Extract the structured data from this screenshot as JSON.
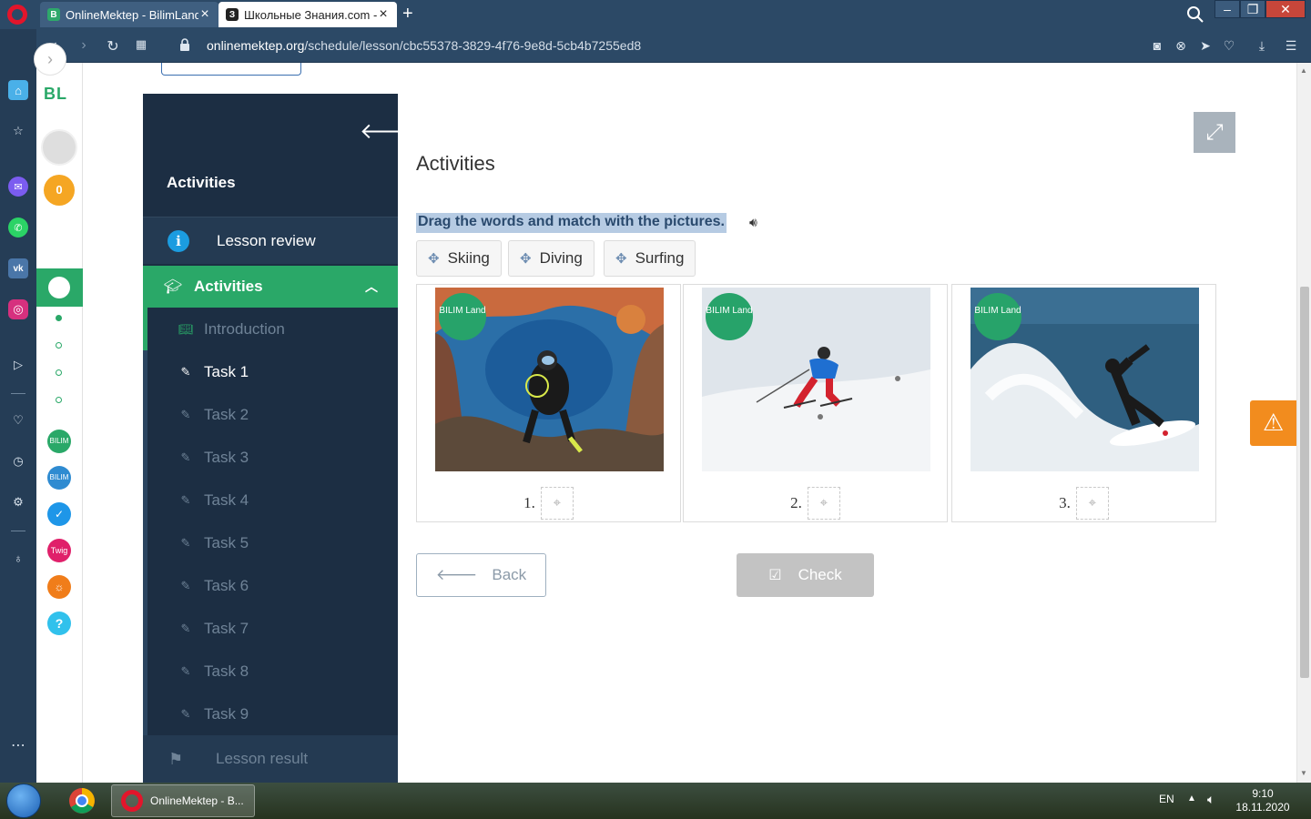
{
  "browser": {
    "tabs": [
      {
        "favicon": "B",
        "title": "OnlineMektep - BilimLand"
      },
      {
        "favicon": "З",
        "title": "Школьные Знания.com - I"
      }
    ],
    "url_host": "onlinemektep.org",
    "url_path": "/schedule/lesson/cbc55378-3829-4f76-9e8d-5cb4b7255ed8"
  },
  "site_sidebar": {
    "logo": "BL",
    "coins": "0",
    "apps": [
      {
        "label": "BILIM Land",
        "color": "#2aa868"
      },
      {
        "label": "BILIM Book",
        "color": "#2f8bd1"
      },
      {
        "label": "✓",
        "color": "#1e96e8"
      },
      {
        "label": "Twig",
        "color": "#e0206a"
      },
      {
        "label": "☼",
        "color": "#f07d1a"
      },
      {
        "label": "?",
        "color": "#31c1ec"
      }
    ]
  },
  "lesson_nav": {
    "title": "Activities",
    "review": "Lesson review",
    "section": "Activities",
    "items": [
      "Introduction",
      "Task 1",
      "Task 2",
      "Task 3",
      "Task 4",
      "Task 5",
      "Task 6",
      "Task 7",
      "Task 8",
      "Task 9"
    ],
    "result": "Lesson result"
  },
  "activity": {
    "heading": "Activities",
    "instruction": "Drag the words and match with the pictures.",
    "words": [
      "Skiing",
      "Diving",
      "Surfing"
    ],
    "pictures": [
      {
        "number": "1.",
        "alt": "Diving"
      },
      {
        "number": "2.",
        "alt": "Skiing"
      },
      {
        "number": "3.",
        "alt": "Surfing"
      }
    ],
    "badge": "BILIM Land",
    "back_label": "Back",
    "check_label": "Check"
  },
  "taskbar": {
    "opera_label": "OnlineMektep - B...",
    "lang": "EN",
    "time": "9:10",
    "date": "18.11.2020"
  },
  "colors": {
    "brand_green": "#2aa868",
    "nav_dark": "#1c2e43",
    "warning_orange": "#f28c1e"
  }
}
